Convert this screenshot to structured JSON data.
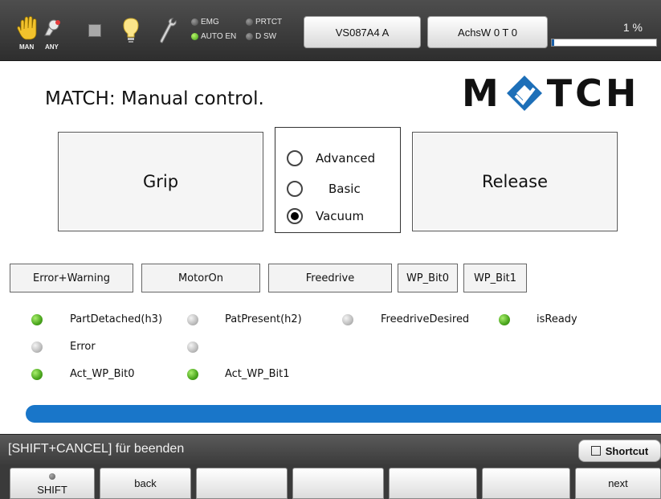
{
  "topbar": {
    "mode_man_label": "MAN",
    "mode_any_label": "ANY",
    "icons": [
      "hand-icon",
      "robot-any-icon",
      "stop-square-icon",
      "bulb-icon",
      "wrench-icon"
    ],
    "lamps": {
      "emg": "EMG",
      "prtct": "PRTCT",
      "auto_en": "AUTO EN",
      "d_sw": "D SW"
    },
    "buttons": {
      "robot": "VS087A4 A",
      "coords": "AchsW 0 T 0"
    },
    "progress_label": "1 %",
    "progress_value": 0.01
  },
  "main": {
    "title": "MATCH: Manual control.",
    "logo_text_left": "M",
    "logo_text_right": "TCH",
    "grip_label": "Grip",
    "release_label": "Release",
    "modes": [
      {
        "label": "Advanced",
        "checked": false
      },
      {
        "label": "Basic",
        "checked": false
      },
      {
        "label": "Vacuum",
        "checked": true
      }
    ],
    "small_buttons": {
      "error_warning": "Error+Warning",
      "motor_on": "MotorOn",
      "freedrive": "Freedrive",
      "wp_bit0": "WP_Bit0",
      "wp_bit1": "WP_Bit1"
    },
    "statuses": {
      "part_detached": {
        "label": "PartDetached(h3)",
        "state": "green"
      },
      "pat_present": {
        "label": "PatPresent(h2)",
        "state": "grey"
      },
      "freedrive_desired": {
        "label": "FreedriveDesired",
        "state": "grey"
      },
      "is_ready": {
        "label": "isReady",
        "state": "green"
      },
      "error": {
        "label": "Error",
        "state": "grey"
      },
      "unnamed": {
        "label": "",
        "state": "grey"
      },
      "act_wp_bit0": {
        "label": "Act_WP_Bit0",
        "state": "green"
      },
      "act_wp_bit1": {
        "label": "Act_WP_Bit1",
        "state": "green"
      }
    }
  },
  "bottom": {
    "message": "[SHIFT+CANCEL] für beenden",
    "shortcut_label": "Shortcut",
    "keys": {
      "shift": "SHIFT",
      "back": "back",
      "next": "next"
    }
  },
  "colors": {
    "accent_blue": "#1976c9",
    "led_green": "#4aa51d",
    "led_grey": "#bdbdbd",
    "topbar_bg": "#3e3e3e"
  }
}
